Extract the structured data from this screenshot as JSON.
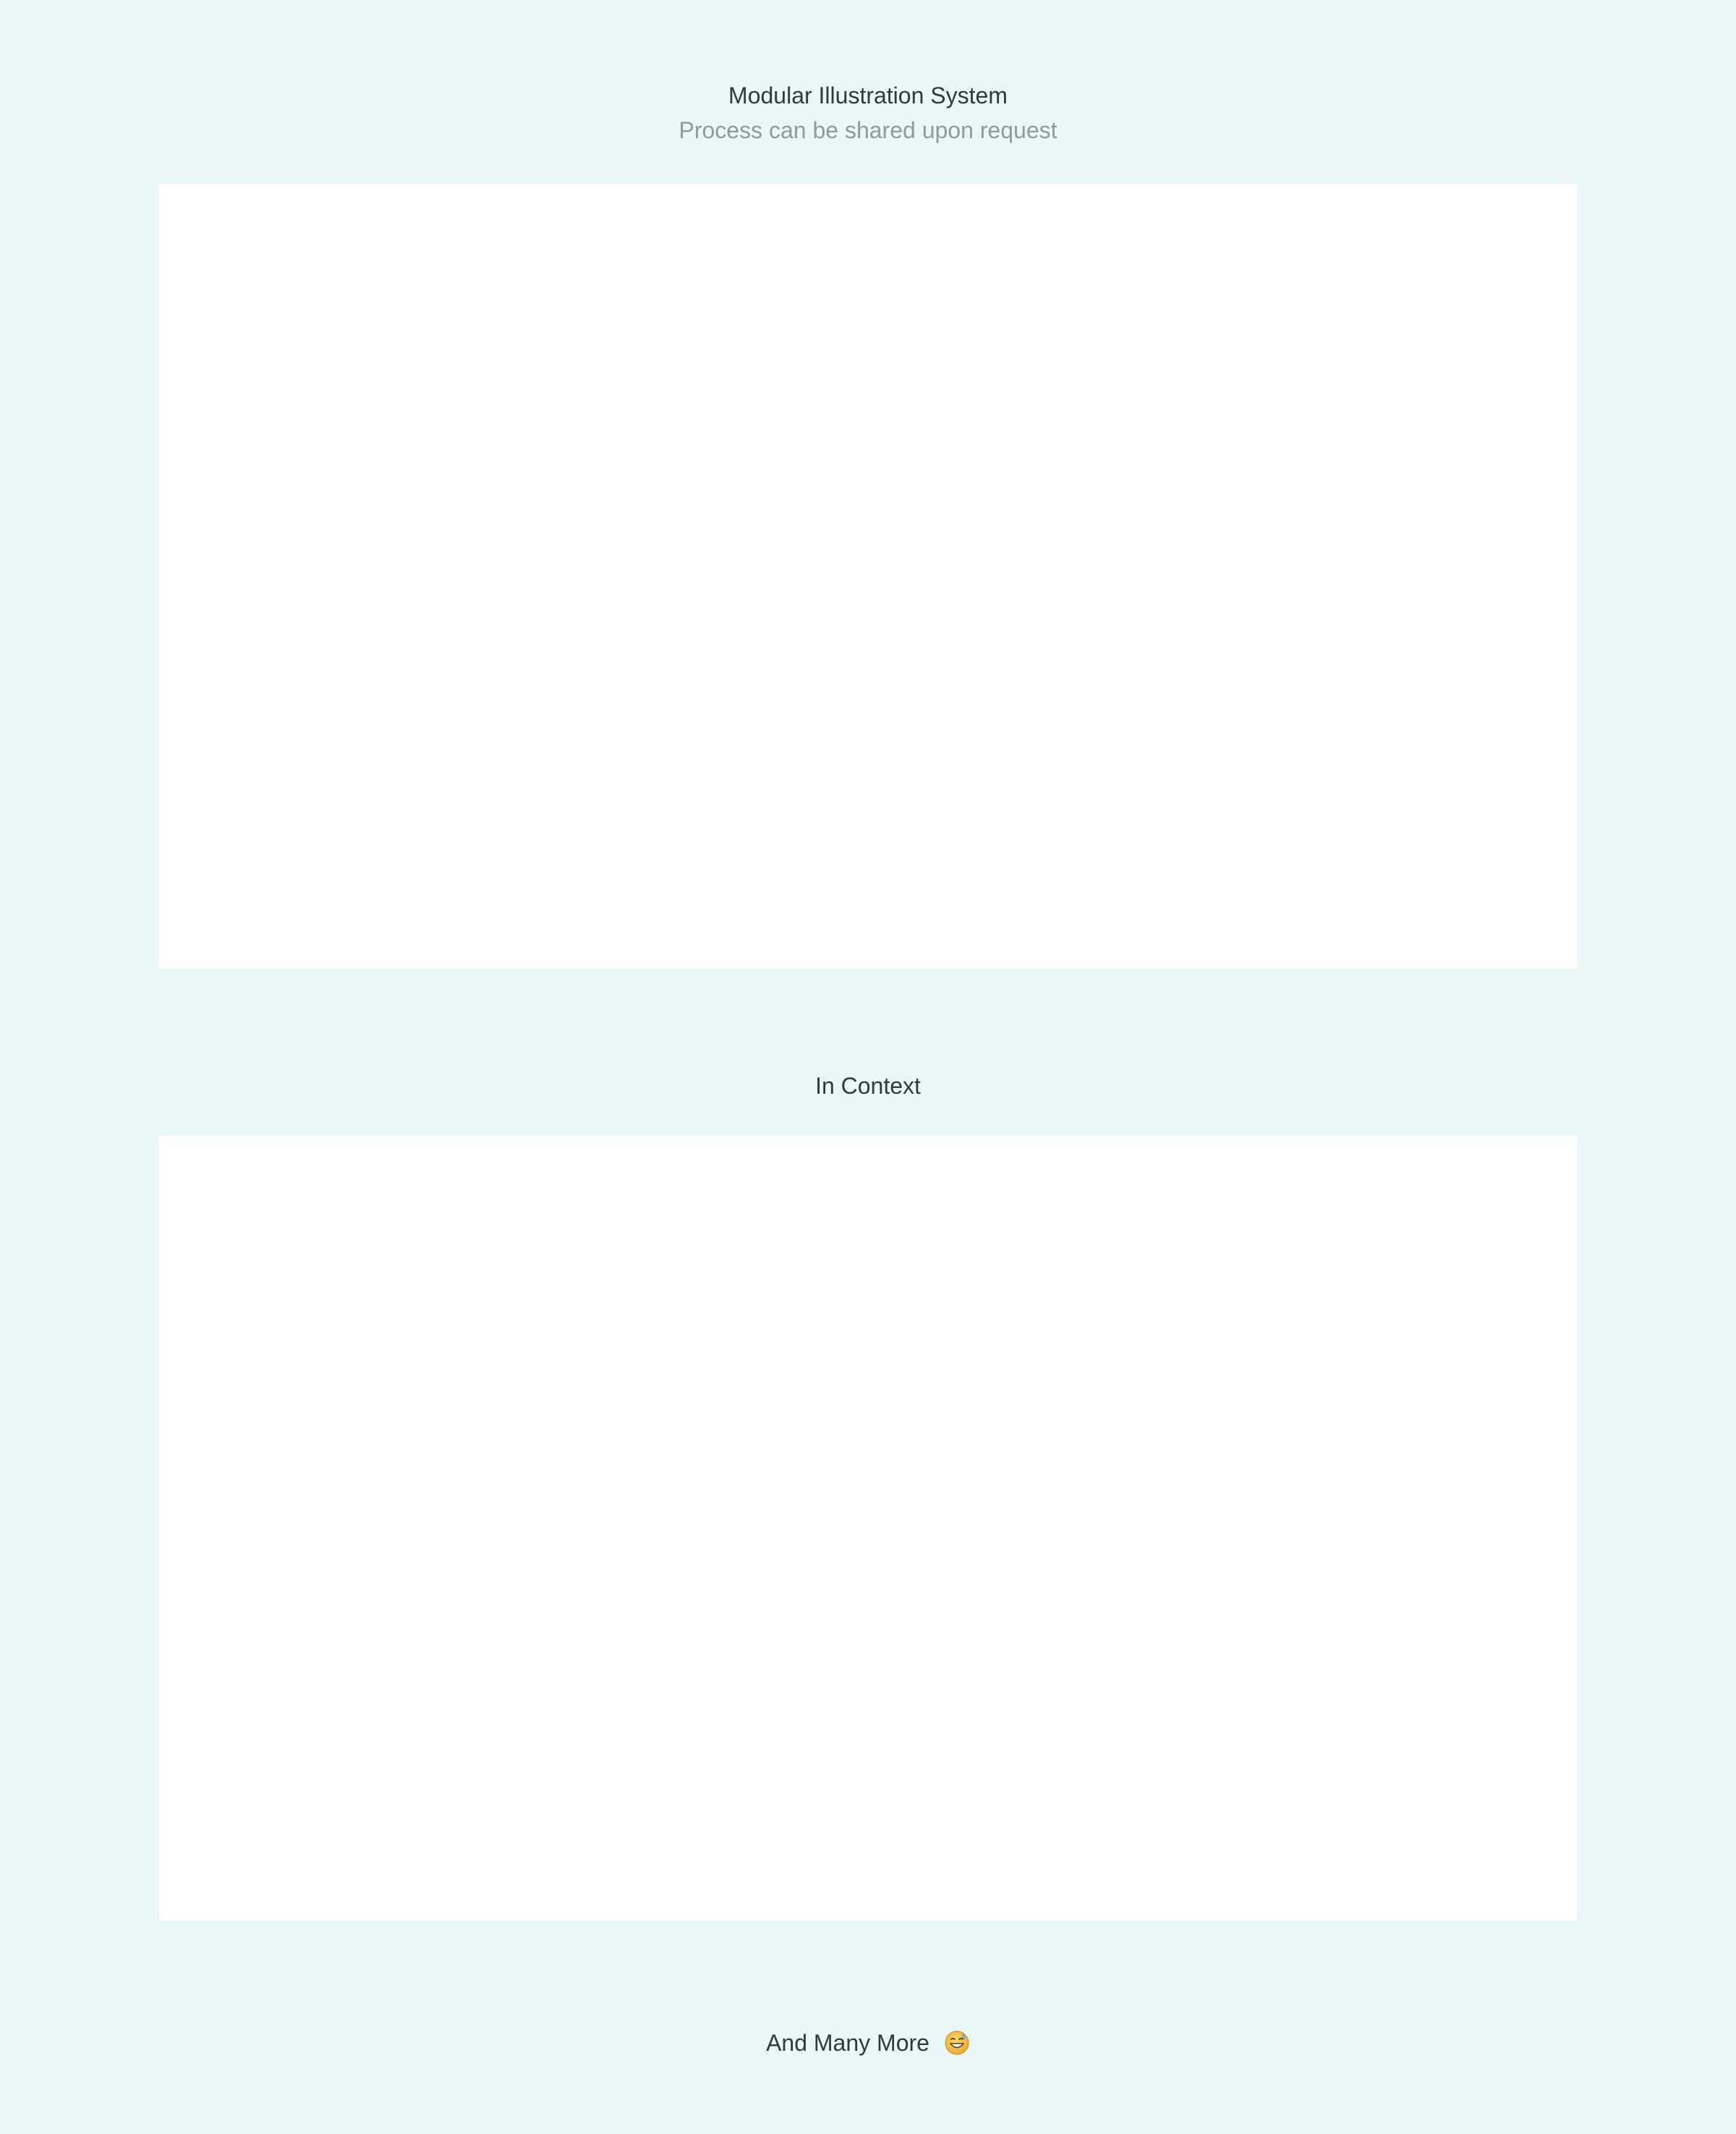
{
  "header": {
    "title": "Modular Illustration System",
    "subtitle": "Process can be shared upon request"
  },
  "context": {
    "title": "In Context"
  },
  "footer": {
    "label": "And Many More",
    "emoji_icon": "grinning-sweat-emoji-icon"
  },
  "colors": {
    "background": "#ebf6f7",
    "panel": "#ffffff",
    "heading": "#2f3a3e",
    "muted": "#8f9a9e",
    "emoji_face": "#f5b83d"
  }
}
